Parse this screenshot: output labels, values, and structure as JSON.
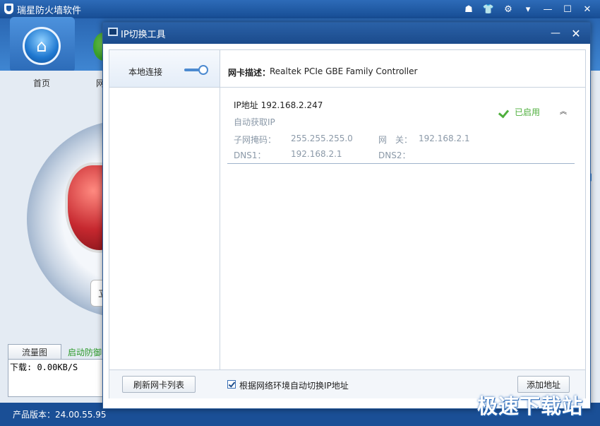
{
  "background_app": {
    "title": "瑞星防火墙软件",
    "window_controls": [
      "☗",
      "👕",
      "⚙",
      "▾",
      "—",
      "☐",
      "✕"
    ],
    "nav": {
      "home_label": "首页",
      "second_label": "网"
    },
    "dial_button_text": "立",
    "tabs": {
      "traffic": "流量图",
      "defense": "启动防御"
    },
    "download_text": "下载: 0.00KB/S",
    "version": "产品版本：24.00.55.95"
  },
  "dialog": {
    "title": "IP切换工具",
    "minimize": "—",
    "close": "✕",
    "sidebar": {
      "items": [
        {
          "label": "本地连接",
          "enabled": true
        }
      ]
    },
    "nic": {
      "label": "网卡描述：",
      "value": "Realtek PCIe GBE Family Controller"
    },
    "ip_entry": {
      "heading": "IP地址 192.168.2.247",
      "mode": "自动获取IP",
      "subnet_label": "子网掩码：",
      "subnet_value": "255.255.255.0",
      "gateway_label": "网　关：",
      "gateway_value": "192.168.2.1",
      "dns1_label": "DNS1：",
      "dns1_value": "192.168.2.1",
      "dns2_label": "DNS2：",
      "dns2_value": "",
      "status": "已启用",
      "collapse_glyph": "︽"
    },
    "footer": {
      "refresh_button": "刷新网卡列表",
      "auto_switch_label": "根据网络环境自动切换IP地址",
      "auto_switch_checked": true,
      "add_button": "添加地址"
    }
  },
  "watermark": "极速下载站",
  "colors": {
    "title_blue": "#1b4b8c",
    "toggle_blue": "#4c8ad0",
    "enabled_green": "#4faf3d",
    "muted_text": "#8b99a8"
  }
}
